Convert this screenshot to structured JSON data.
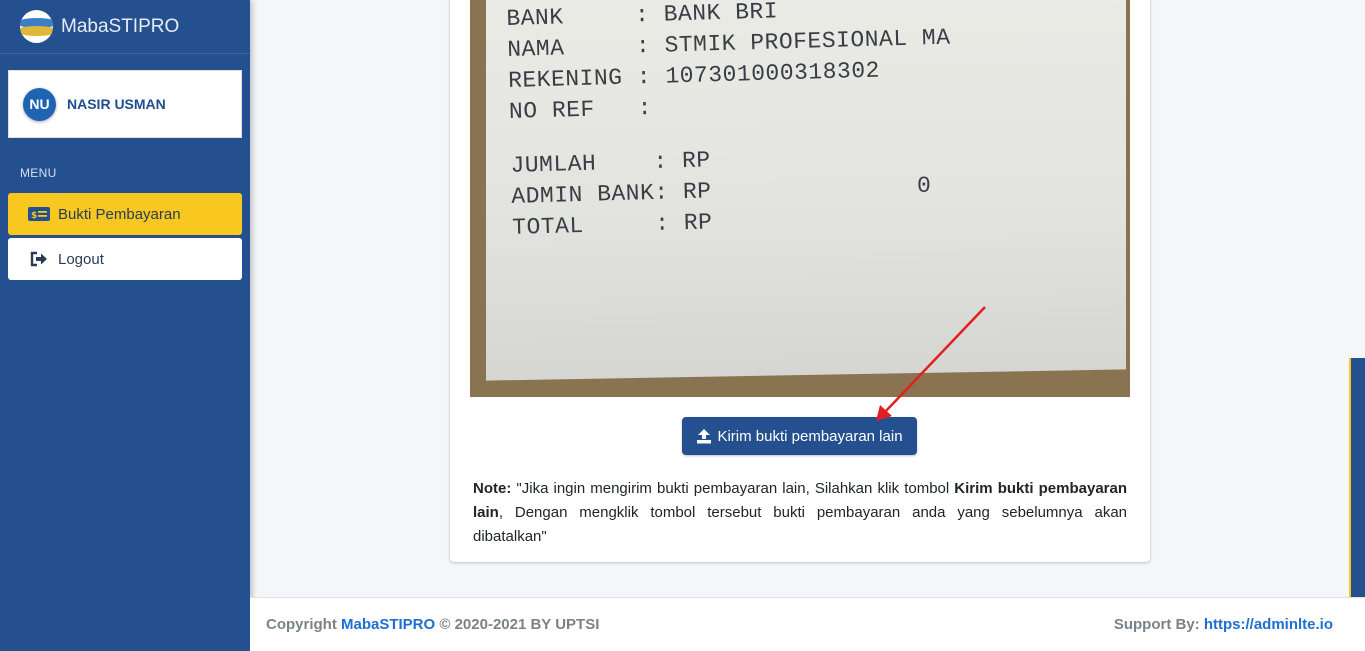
{
  "brand": {
    "name": "MabaSTIPRO",
    "logo_icon": "brand-logo-icon"
  },
  "user": {
    "initials": "NU",
    "name": "NASIR USMAN"
  },
  "sidebar": {
    "menu_header": "MENU",
    "items": [
      {
        "label": "Bukti Pembayaran",
        "icon": "money-bill-icon",
        "active": true
      },
      {
        "label": "Logout",
        "icon": "sign-out-icon",
        "active": false
      }
    ]
  },
  "receipt": {
    "lines": [
      "BANK     : BANK BRI",
      "NAMA     : STMIK PROFESIONAL MA",
      "REKENING : 107301000318302",
      "NO REF   :",
      "JUMLAH    : RP",
      "ADMIN BANK: RP",
      "TOTAL     : RP"
    ],
    "admin_value": "0"
  },
  "actions": {
    "send_other_label": "Kirim bukti pembayaran lain",
    "send_icon": "upload-icon"
  },
  "note": {
    "prefix": "Note:",
    "text_1": " \"Jika ingin mengirim bukti pembayaran lain, Silahkan klik tombol ",
    "emphasis": "Kirim bukti pembayaran lain",
    "text_2": ", Dengan mengklik tombol tersebut bukti pembayaran anda yang sebelumnya akan dibatalkan\""
  },
  "footer": {
    "copyright_prefix": "Copyright ",
    "copyright_link": "MabaSTIPRO",
    "copyright_suffix": " © 2020-2021 BY UPTSI",
    "support_prefix": "Support By: ",
    "support_link": "https://adminlte.io"
  },
  "colors": {
    "primary": "#25508f",
    "accent": "#f8c820",
    "annotation_arrow": "#e02020"
  }
}
